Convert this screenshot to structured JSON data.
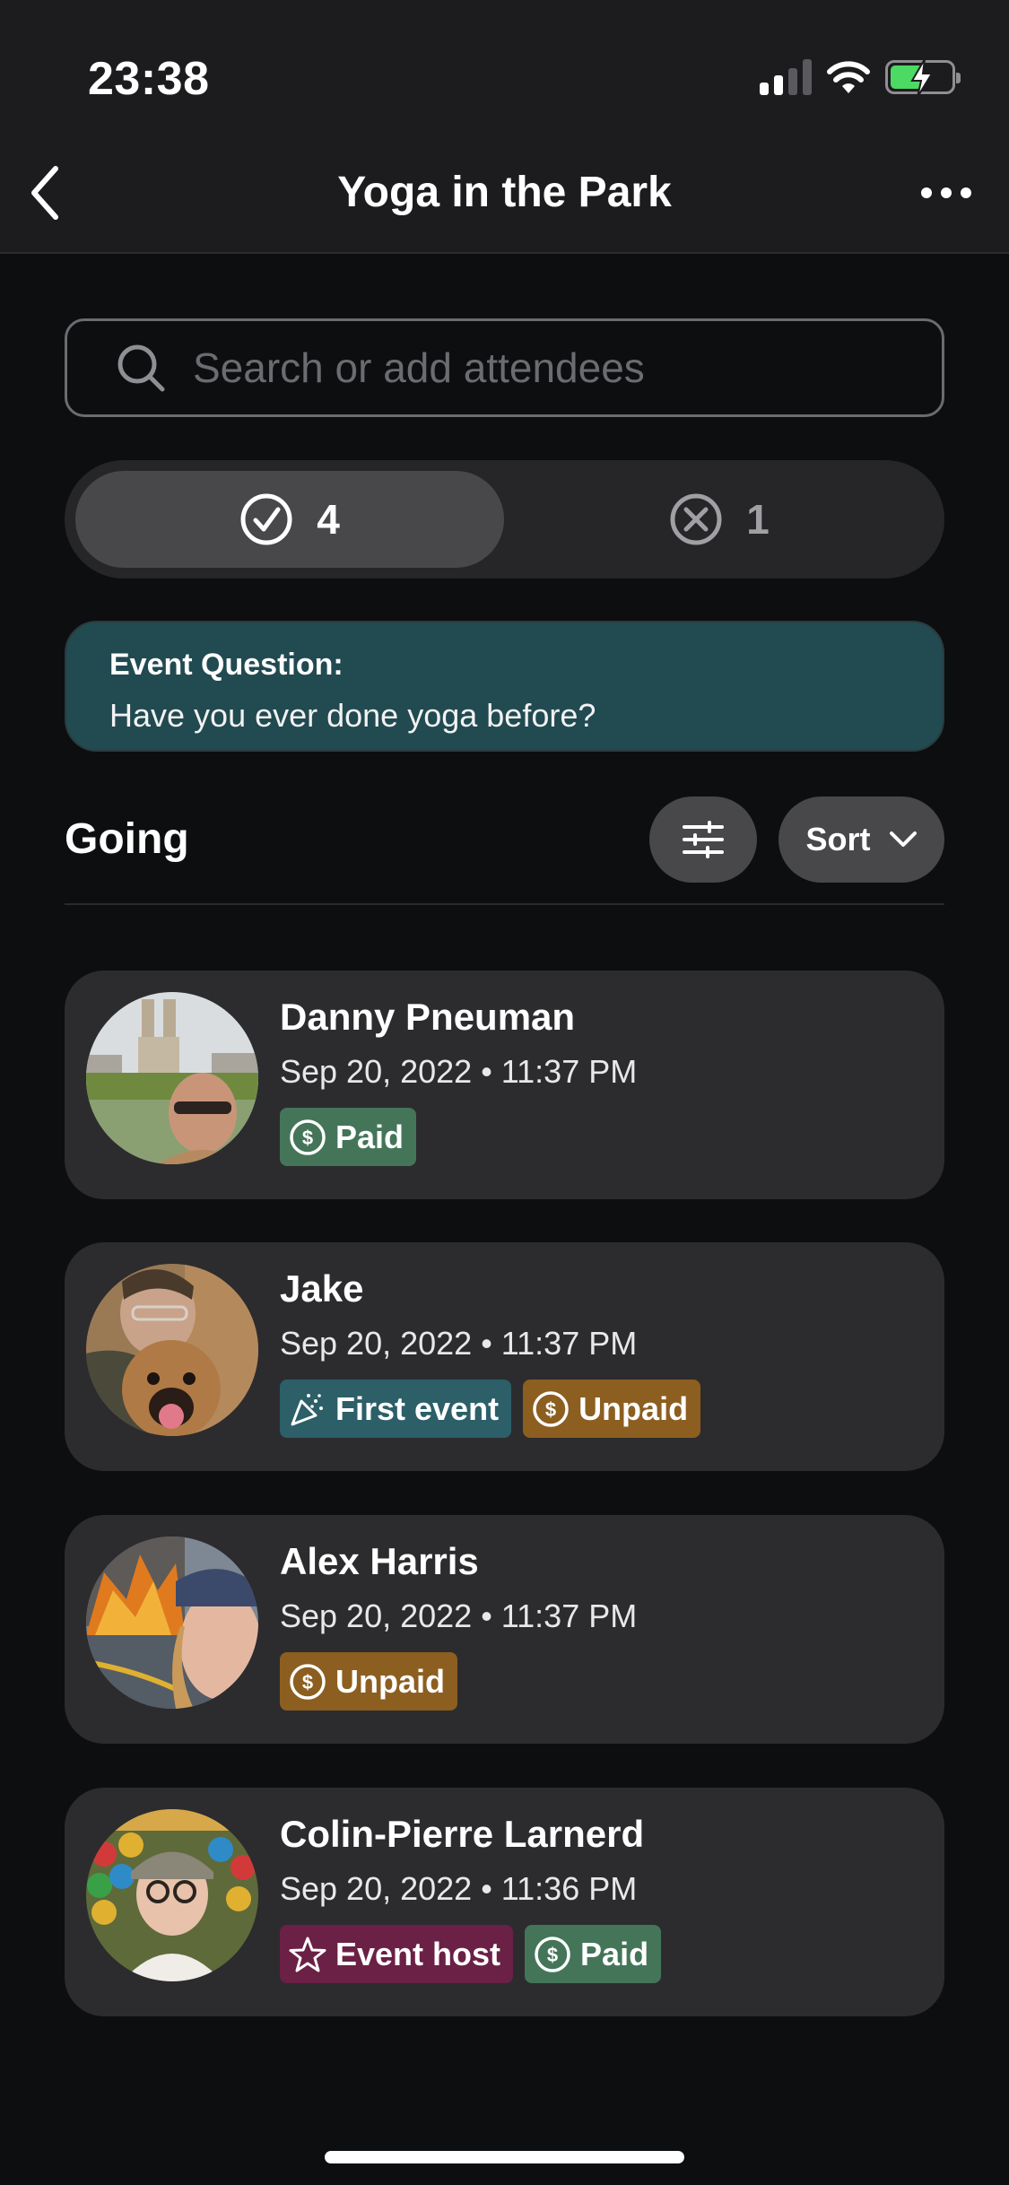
{
  "status_bar": {
    "time": "23:38"
  },
  "nav": {
    "title": "Yoga in the Park",
    "back_icon": "chevron-left-icon",
    "more_icon": "ellipsis-icon"
  },
  "search": {
    "placeholder": "Search or add attendees",
    "value": ""
  },
  "toggle": {
    "going": {
      "count": "4",
      "icon": "check-circle-icon",
      "selected": true
    },
    "not_going": {
      "count": "1",
      "icon": "x-circle-icon",
      "selected": false
    }
  },
  "event_question": {
    "label": "Event Question:",
    "text": "Have you ever done yoga before?"
  },
  "section": {
    "title": "Going",
    "filter_icon": "sliders-icon",
    "sort_label": "Sort"
  },
  "attendees": [
    {
      "name": "Danny Pneuman",
      "datetime": "Sep 20, 2022 • 11:37 PM",
      "badges": [
        {
          "label": "Paid",
          "type": "paid",
          "icon": "dollar-circle-icon"
        }
      ]
    },
    {
      "name": "Jake",
      "datetime": "Sep 20, 2022 • 11:37 PM",
      "badges": [
        {
          "label": "First event",
          "type": "first",
          "icon": "party-popper-icon"
        },
        {
          "label": "Unpaid",
          "type": "unpaid",
          "icon": "dollar-circle-icon"
        }
      ]
    },
    {
      "name": "Alex Harris",
      "datetime": "Sep 20, 2022 • 11:37 PM",
      "badges": [
        {
          "label": "Unpaid",
          "type": "unpaid",
          "icon": "dollar-circle-icon"
        }
      ]
    },
    {
      "name": "Colin-Pierre Larnerd",
      "datetime": "Sep 20, 2022 • 11:36 PM",
      "badges": [
        {
          "label": "Event host",
          "type": "host",
          "icon": "star-icon"
        },
        {
          "label": "Paid",
          "type": "paid",
          "icon": "dollar-circle-icon"
        }
      ]
    }
  ],
  "colors": {
    "background": "#0d0e10",
    "card": "#2c2c2e",
    "question_bg": "#214a51",
    "paid": "#447559",
    "unpaid": "#8c5e20",
    "first_event": "#2c5f68",
    "event_host": "#6b2045",
    "battery": "#4cd964"
  }
}
